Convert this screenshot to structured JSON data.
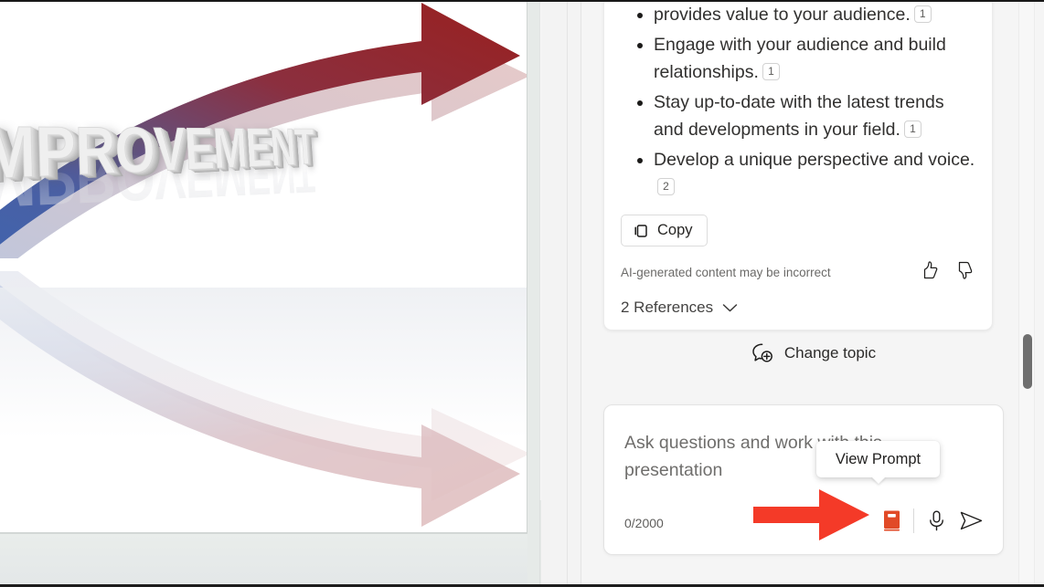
{
  "slide": {
    "wordmark": "IMPROVEMENT",
    "alt": "3D white IMPROVEMENT text with curved blue-to-red gradient arrow",
    "background_color": "#ffffff",
    "arrow_gradient_start": "#3f63ad",
    "arrow_gradient_end": "#9c1f20",
    "pane_background": "#e6eae8"
  },
  "answer": {
    "bullets": [
      {
        "text": "provides value to your audience.",
        "citation": "1",
        "clipped": true
      },
      {
        "text": "Engage with your audience and build relationships.",
        "citation": "1",
        "clipped": false
      },
      {
        "text": "Stay up-to-date with the latest trends and developments in your field.",
        "citation": "1",
        "clipped": false
      },
      {
        "text": "Develop a unique perspective and voice.",
        "citation": "2",
        "clipped": false
      }
    ],
    "copy_label": "Copy",
    "disclaimer": "AI-generated content may be incorrect",
    "references_label": "2 References"
  },
  "change_topic": {
    "label": "Change topic"
  },
  "composer": {
    "placeholder": "Ask questions and work with this presentation",
    "char_count": "0/2000",
    "prompt_icon_color": "#E14A27",
    "actions": [
      {
        "name": "view-prompt-button",
        "icon": "book-icon"
      },
      {
        "name": "dictate-button",
        "icon": "microphone-icon"
      },
      {
        "name": "send-button",
        "icon": "send-icon"
      }
    ]
  },
  "tooltip": {
    "text": "View Prompt"
  },
  "annotation": {
    "color": "#F43A28",
    "shape": "right-arrow"
  },
  "scrollbars": {
    "slide_thumb_color": "#6e6e6e",
    "chat_thumb_color": "#6e6e6e"
  },
  "slide_nav": {
    "previous": "previous-slide",
    "next": "next-slide"
  }
}
